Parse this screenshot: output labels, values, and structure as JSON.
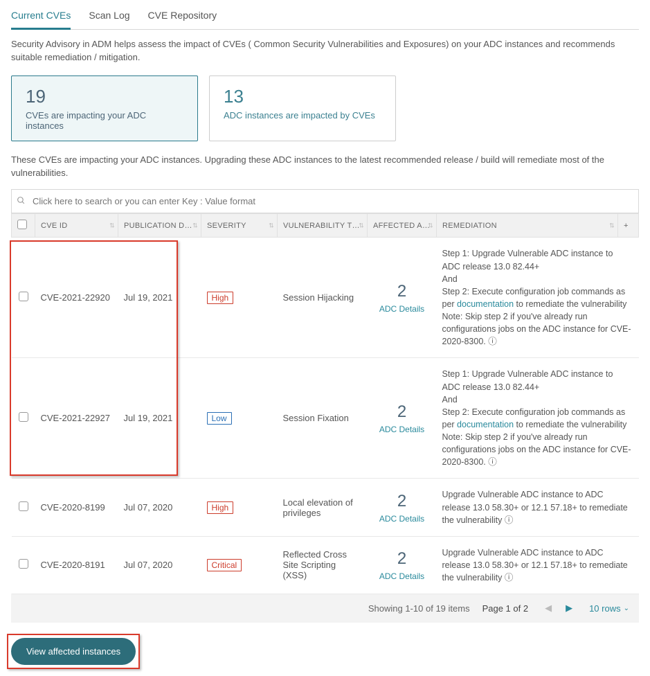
{
  "tabs": {
    "current": "Current CVEs",
    "scanlog": "Scan Log",
    "repo": "CVE Repository"
  },
  "advisory_text": "Security Advisory in ADM helps assess the impact of CVEs ( Common Security Vulnerabilities and Exposures) on your ADC instances and recommends suitable remediation / mitigation.",
  "cards": {
    "cve": {
      "number": "19",
      "label": "CVEs are impacting your ADC instances"
    },
    "adc": {
      "number": "13",
      "label": "ADC instances are impacted by CVEs"
    }
  },
  "impact_text": "These CVEs are impacting your ADC instances. Upgrading these ADC instances to the latest recommended release / build will remediate most of the vulnerabilities.",
  "search": {
    "placeholder": "Click here to search or you can enter Key : Value format"
  },
  "headers": {
    "cveid": "CVE ID",
    "pubdate": "PUBLICATION DATE",
    "severity": "SEVERITY",
    "vulntype": "VULNERABILITY TY...",
    "affected": "AFFECTED ADC INS...",
    "remediation": "REMEDIATION"
  },
  "rows": [
    {
      "cve": "CVE-2021-22920",
      "date": "Jul 19, 2021",
      "severity": "High",
      "sev_class": "sev-high",
      "vuln": "Session Hijacking",
      "count": "2",
      "aff_link": "ADC Details",
      "rem_pre": "Step 1: Upgrade Vulnerable ADC instance to ADC release 13.0 82.44+\nAnd\nStep 2: Execute configuration job commands as per ",
      "rem_link": "documentation",
      "rem_post": " to remediate the vulnerability\nNote: Skip step 2 if you've already run configurations jobs on the ADC instance for CVE-2020-8300. ⓘ"
    },
    {
      "cve": "CVE-2021-22927",
      "date": "Jul 19, 2021",
      "severity": "Low",
      "sev_class": "sev-low",
      "vuln": "Session Fixation",
      "count": "2",
      "aff_link": "ADC Details",
      "rem_pre": "Step 1: Upgrade Vulnerable ADC instance to ADC release 13.0 82.44+\nAnd\nStep 2: Execute configuration job commands as per ",
      "rem_link": "documentation",
      "rem_post": " to remediate the vulnerability\nNote: Skip step 2 if you've already run configurations jobs on the ADC instance for CVE-2020-8300. ⓘ"
    },
    {
      "cve": "CVE-2020-8199",
      "date": "Jul 07, 2020",
      "severity": "High",
      "sev_class": "sev-high",
      "vuln": "Local elevation of privileges",
      "count": "2",
      "aff_link": "ADC Details",
      "rem_pre": "Upgrade Vulnerable ADC instance to ADC release 13.0 58.30+ or 12.1 57.18+ to remediate the vulnerability ⓘ",
      "rem_link": "",
      "rem_post": ""
    },
    {
      "cve": "CVE-2020-8191",
      "date": "Jul 07, 2020",
      "severity": "Critical",
      "sev_class": "sev-critical",
      "vuln": "Reflected Cross Site Scripting (XSS)",
      "count": "2",
      "aff_link": "ADC Details",
      "rem_pre": "Upgrade Vulnerable ADC instance to ADC release 13.0 58.30+ or 12.1 57.18+ to remediate the vulnerability ⓘ",
      "rem_link": "",
      "rem_post": ""
    }
  ],
  "pager": {
    "showing": "Showing 1-10 of 19 items",
    "page": "Page 1 of 2",
    "rows": "10 rows"
  },
  "view_button": "View affected instances"
}
